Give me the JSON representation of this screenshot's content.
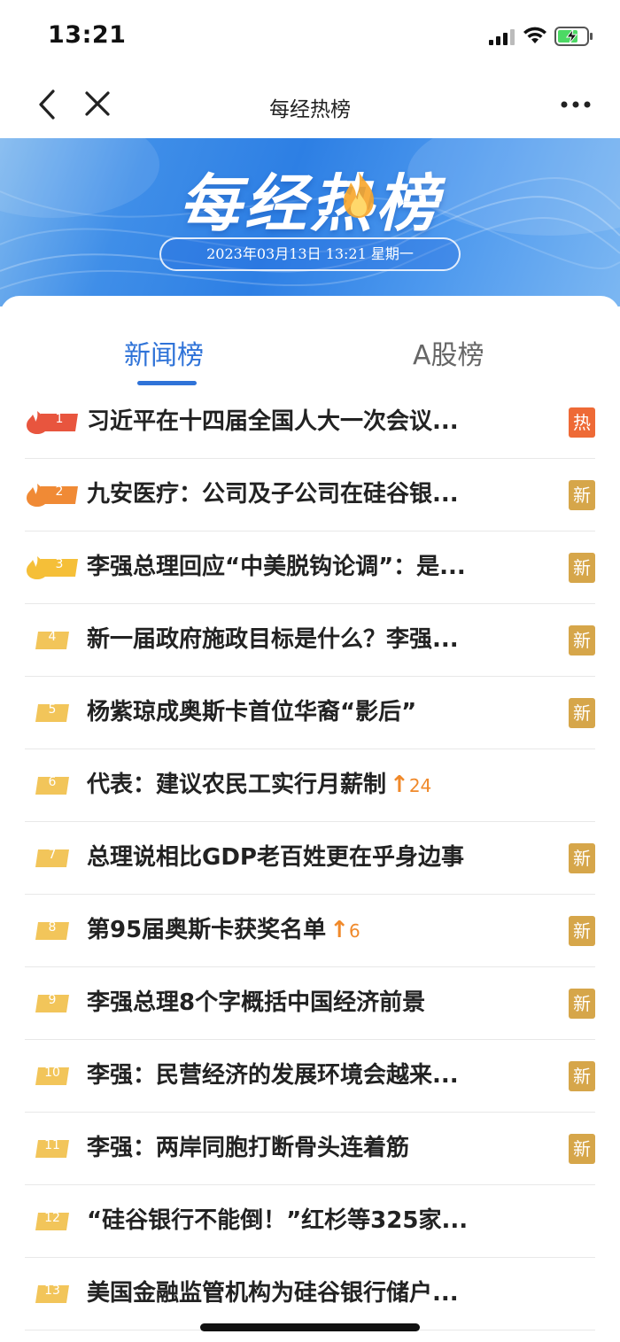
{
  "status_bar": {
    "time": "13:21"
  },
  "nav": {
    "title": "每经热榜"
  },
  "banner": {
    "title": "每经热榜",
    "date": "2023年03月13日 13:21 星期一"
  },
  "tabs": [
    {
      "label": "新闻榜",
      "active": true
    },
    {
      "label": "A股榜",
      "active": false
    }
  ],
  "colors": {
    "accent": "#2f73d8",
    "hot_tag": "#ee6a36",
    "new_tag": "#d6a64a",
    "trend": "#f0892a",
    "rank_top1": "#e8553e",
    "rank_top2": "#f08a35",
    "rank_top3": "#f5bf38",
    "rank_other": "#f2c55a"
  },
  "items": [
    {
      "rank": "1",
      "title": "习近平在十四届全国人大一次会议...",
      "tag": "热",
      "trend": ""
    },
    {
      "rank": "2",
      "title": "九安医疗：公司及子公司在硅谷银...",
      "tag": "新",
      "trend": ""
    },
    {
      "rank": "3",
      "title": "李强总理回应“中美脱钩论调”：是...",
      "tag": "新",
      "trend": ""
    },
    {
      "rank": "4",
      "title": "新一届政府施政目标是什么？李强...",
      "tag": "新",
      "trend": ""
    },
    {
      "rank": "5",
      "title": "杨紫琼成奥斯卡首位华裔“影后”",
      "tag": "新",
      "trend": ""
    },
    {
      "rank": "6",
      "title": "代表：建议农民工实行月薪制",
      "tag": "",
      "trend": "24"
    },
    {
      "rank": "7",
      "title": "总理说相比GDP老百姓更在乎身边事",
      "tag": "新",
      "trend": ""
    },
    {
      "rank": "8",
      "title": "第95届奥斯卡获奖名单",
      "tag": "新",
      "trend": "6"
    },
    {
      "rank": "9",
      "title": "李强总理8个字概括中国经济前景",
      "tag": "新",
      "trend": ""
    },
    {
      "rank": "10",
      "title": "李强：民营经济的发展环境会越来...",
      "tag": "新",
      "trend": ""
    },
    {
      "rank": "11",
      "title": "李强：两岸同胞打断骨头连着筋",
      "tag": "新",
      "trend": ""
    },
    {
      "rank": "12",
      "title": "“硅谷银行不能倒！”红杉等325家...",
      "tag": "",
      "trend": ""
    },
    {
      "rank": "13",
      "title": "美国金融监管机构为硅谷银行储户...",
      "tag": "",
      "trend": ""
    }
  ]
}
